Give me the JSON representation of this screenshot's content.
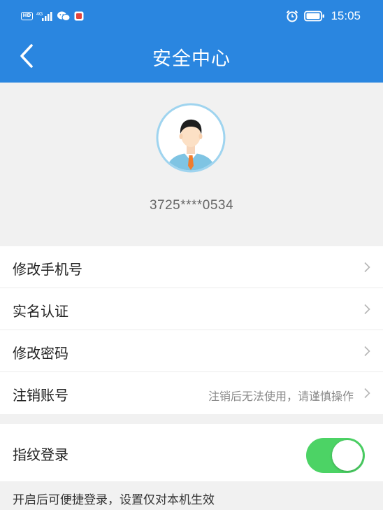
{
  "status_bar": {
    "hd_label": "HD",
    "network_label": "4G",
    "time": "15:05",
    "icons": [
      "hd-icon",
      "signal-icon",
      "wechat-icon",
      "app-notification-icon",
      "alarm-icon",
      "battery-icon"
    ]
  },
  "header": {
    "title": "安全中心",
    "back_icon": "chevron-left-icon"
  },
  "profile": {
    "avatar_icon": "user-avatar-icon",
    "account_id": "3725****0534"
  },
  "menu": {
    "items": [
      {
        "label": "修改手机号",
        "hint": ""
      },
      {
        "label": "实名认证",
        "hint": ""
      },
      {
        "label": "修改密码",
        "hint": ""
      },
      {
        "label": "注销账号",
        "hint": "注销后无法使用，请谨慎操作"
      }
    ]
  },
  "fingerprint": {
    "label": "指纹登录",
    "enabled": true,
    "note": "开启后可便捷登录，设置仅对本机生效"
  },
  "colors": {
    "primary": "#2a86e0",
    "toggle_on": "#4cd365",
    "background": "#f1f1f1"
  }
}
